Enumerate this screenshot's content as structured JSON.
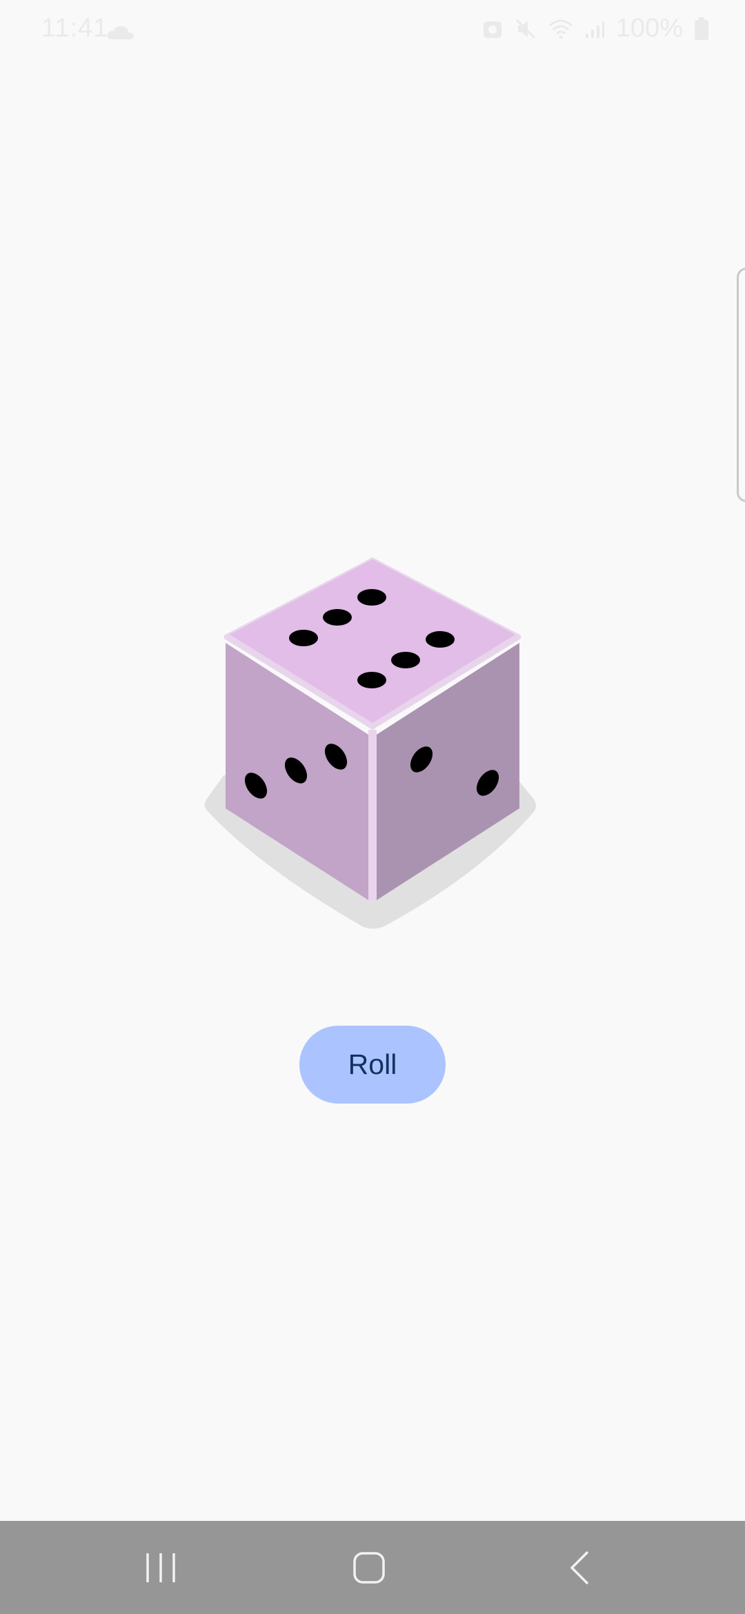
{
  "status_bar": {
    "time": "11:41",
    "battery": "100%",
    "icons": [
      "cloud-icon",
      "alarm-icon",
      "mute-icon",
      "wifi-icon",
      "signal-icon",
      "battery-icon"
    ]
  },
  "dice": {
    "top_face_pips": 6,
    "left_face_pips": 3,
    "right_face_pips": 2,
    "colors": {
      "top": "#e1bde8",
      "left": "#c1a4c8",
      "right": "#aa93b0",
      "edge": "#e8d5ec",
      "shadow": "#e0e0e0",
      "pip": "#000000"
    }
  },
  "roll_button": {
    "label": "Roll",
    "color": "#abc4ff",
    "text_color": "#11325f"
  },
  "nav_bar": {
    "color": "#969696",
    "buttons": [
      "recents-icon",
      "home-icon",
      "back-icon"
    ]
  }
}
